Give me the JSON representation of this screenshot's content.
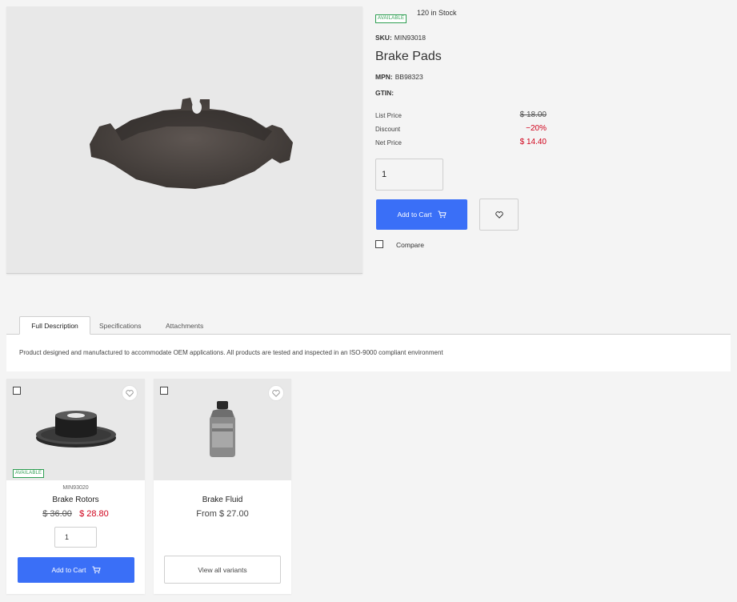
{
  "product": {
    "availability": "AVAILABLE",
    "stock": "120 in Stock",
    "sku_label": "SKU:",
    "sku": "MIN93018",
    "title": "Brake Pads",
    "mpn_label": "MPN:",
    "mpn": "BB98323",
    "gtin_label": "GTIN:",
    "gtin": "",
    "prices": {
      "list_label": "List Price",
      "list_value": "$ 18.00",
      "discount_label": "Discount",
      "discount_value": "−20%",
      "net_label": "Net Price",
      "net_value": "$ 14.40"
    },
    "quantity": "1",
    "add_to_cart": "Add to Cart",
    "compare": "Compare"
  },
  "tabs": [
    {
      "label": "Full Description",
      "active": true
    },
    {
      "label": "Specifications",
      "active": false
    },
    {
      "label": "Attachments",
      "active": false
    }
  ],
  "description": "Product designed and manufactured to accommodate OEM applications. All products are tested and inspected in an ISO-9000 compliant environment",
  "related": [
    {
      "sku": "MIN93020",
      "name": "Brake Rotors",
      "availability": "AVAILABLE",
      "list_price": "$ 36.00",
      "net_price": "$ 28.80",
      "quantity": "1",
      "button": "Add to Cart"
    },
    {
      "name": "Brake Fluid",
      "price": "From $ 27.00",
      "button": "View all variants"
    }
  ],
  "colors": {
    "accent": "#3a6ff7",
    "sale_red": "#d0021b",
    "available_green": "#2e9e52"
  },
  "icons": {
    "cart": "cart-icon",
    "wishlist": "heart-icon"
  }
}
